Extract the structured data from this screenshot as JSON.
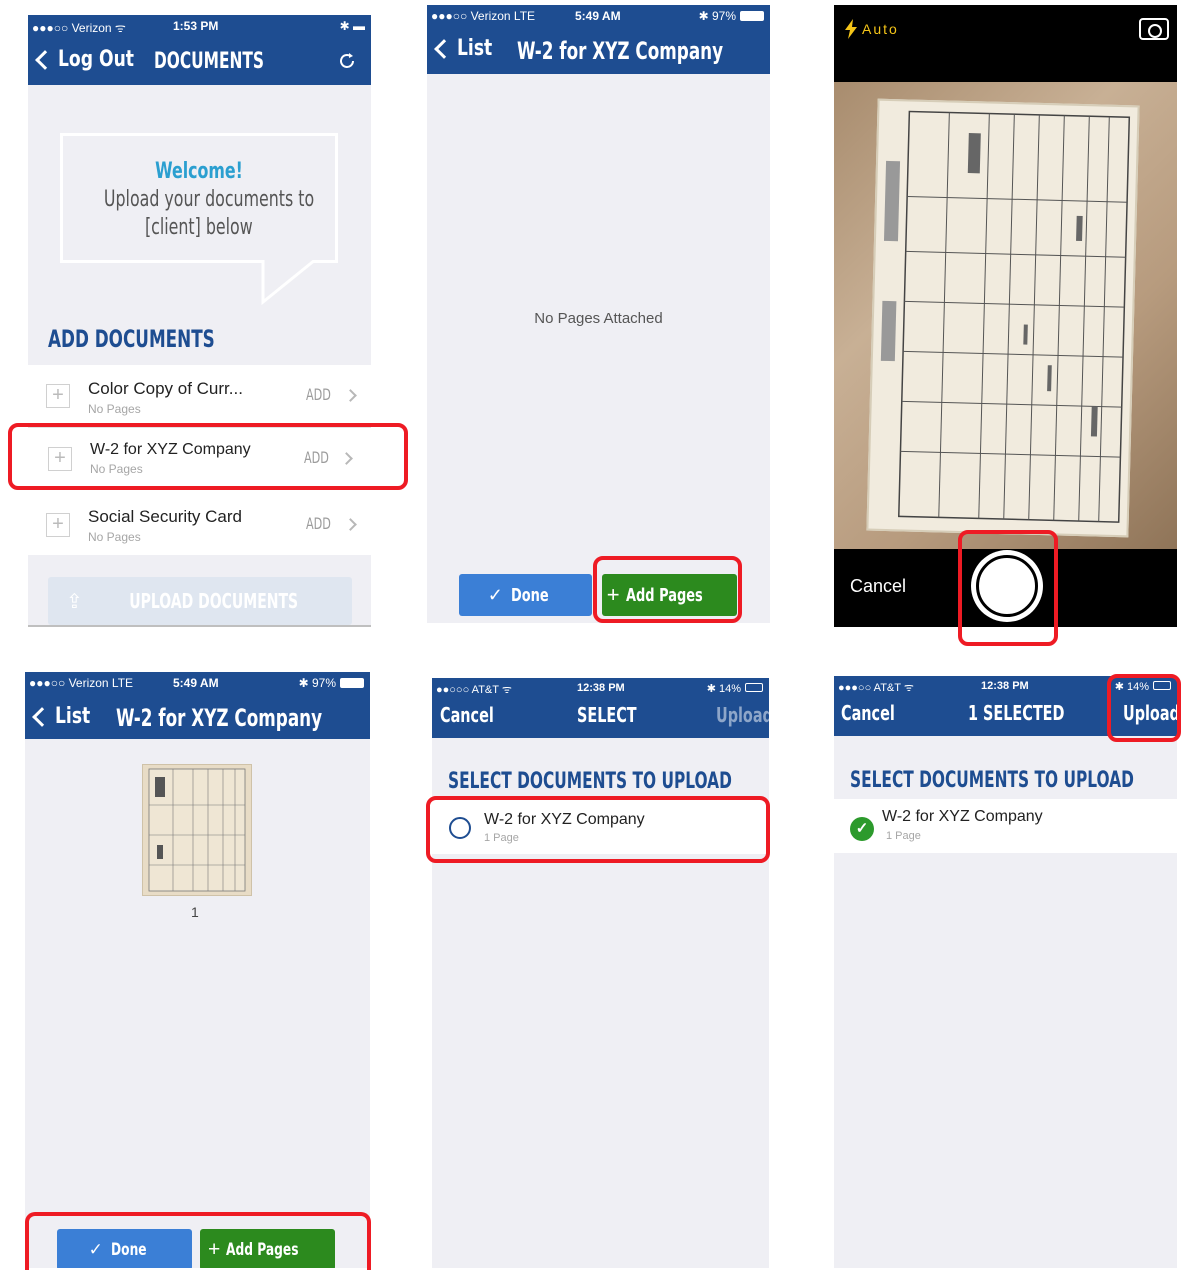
{
  "screens": {
    "s1": {
      "status": {
        "carrier": "●●●○○ Verizon ᯤ",
        "time": "1:53 PM",
        "battery": "✱ ▬"
      },
      "nav": {
        "back": "Log Out",
        "title": "DOCUMENTS",
        "refresh_icon": "refresh-icon"
      },
      "welcome": {
        "line1": "Welcome!",
        "line2": "Upload your documents to",
        "line3": "[client] below"
      },
      "section_header": "ADD DOCUMENTS",
      "items": [
        {
          "title": "Color Copy of Curr...",
          "sub": "No Pages",
          "action": "ADD"
        },
        {
          "title": "W-2 for XYZ Company",
          "sub": "No Pages",
          "action": "ADD"
        },
        {
          "title": "Social Security Card",
          "sub": "No Pages",
          "action": "ADD"
        }
      ],
      "upload_button": "UPLOAD DOCUMENTS"
    },
    "s2": {
      "status": {
        "carrier": "●●●○○ Verizon  LTE",
        "time": "5:49 AM",
        "battery": "✱ 97%"
      },
      "nav": {
        "back": "List",
        "title": "W-2 for XYZ Company"
      },
      "empty_text": "No Pages Attached",
      "done": "Done",
      "add_pages": "Add Pages"
    },
    "s3": {
      "flash": "Auto",
      "cancel": "Cancel"
    },
    "s4": {
      "status": {
        "carrier": "●●●○○ Verizon  LTE",
        "time": "5:49 AM",
        "battery": "✱ 97%"
      },
      "nav": {
        "back": "List",
        "title": "W-2 for XYZ Company"
      },
      "page_number": "1",
      "done": "Done",
      "add_pages": "Add Pages"
    },
    "s5": {
      "status": {
        "carrier": "●●○○○ AT&T ᯤ",
        "time": "12:38 PM",
        "battery": "✱ 14%"
      },
      "nav": {
        "cancel": "Cancel",
        "title": "SELECT",
        "upload": "Upload"
      },
      "section_header": "SELECT DOCUMENTS TO UPLOAD",
      "item": {
        "title": "W-2 for XYZ Company",
        "sub": "1 Page"
      }
    },
    "s6": {
      "status": {
        "carrier": "●●●○○ AT&T ᯤ",
        "time": "12:38 PM",
        "battery": "✱ 14%"
      },
      "nav": {
        "cancel": "Cancel",
        "title": "1 SELECTED",
        "upload": "Upload"
      },
      "section_header": "SELECT DOCUMENTS TO UPLOAD",
      "item": {
        "title": "W-2 for XYZ Company",
        "sub": "1 Page"
      }
    }
  },
  "colors": {
    "nav_blue": "#1e4d91",
    "accent_blue": "#3b7fd6",
    "button_green": "#2c8a1e",
    "highlight_red": "#ee1b24",
    "welcome_teal": "#2b9fd0",
    "check_green": "#2c9a2c"
  }
}
